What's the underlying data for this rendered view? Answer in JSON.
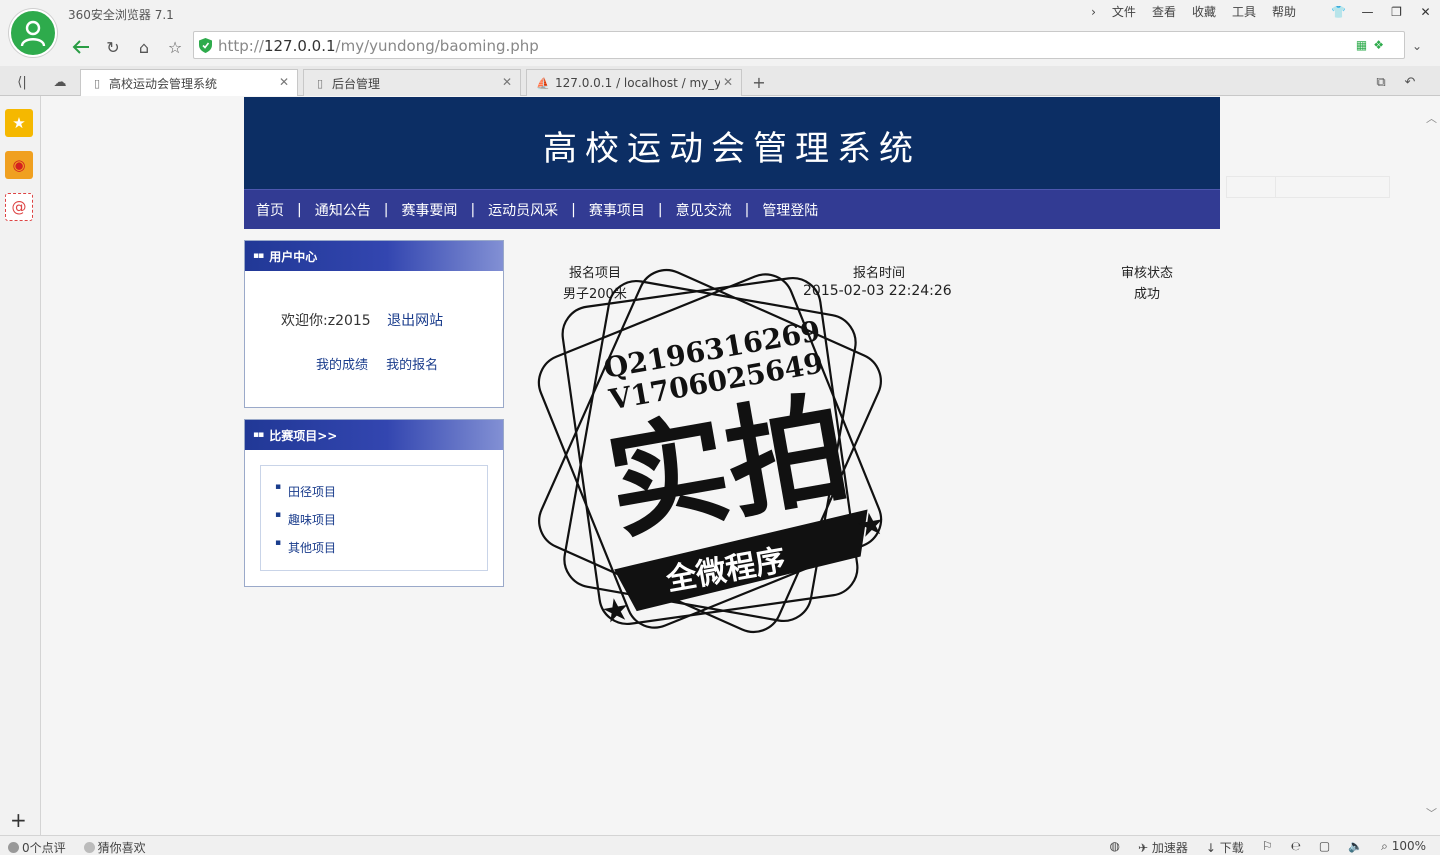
{
  "browser": {
    "app_title": "360安全浏览器 7.1",
    "menu": [
      "文件",
      "查看",
      "收藏",
      "工具",
      "帮助"
    ],
    "url_scheme": "http://",
    "url_host": "127.0.0.1",
    "url_path": "/my/yundong/baoming.php",
    "tabs": [
      {
        "label": "高校运动会管理系统",
        "active": true
      },
      {
        "label": "后台管理",
        "active": false
      },
      {
        "label": "127.0.0.1 / localhost / my_yu",
        "active": false
      }
    ],
    "status_left": [
      "0个点评",
      "猜你喜欢"
    ],
    "status_right": [
      "加速器",
      "下载",
      "100%"
    ]
  },
  "site": {
    "title": "高校运动会管理系统",
    "nav": [
      "首页",
      "通知公告",
      "赛事要闻",
      "运动员风采",
      "赛事项目",
      "意见交流",
      "管理登陆"
    ],
    "user_panel": {
      "title": "用户中心",
      "welcome": "欢迎你:z2015",
      "logout": "退出网站",
      "my_scores": "我的成绩",
      "my_registrations": "我的报名"
    },
    "events_panel": {
      "title": "比赛项目>>",
      "items": [
        "田径项目",
        "趣味项目",
        "其他项目"
      ]
    },
    "registration_table": {
      "headers": [
        "报名项目",
        "报名时间",
        "审核状态"
      ],
      "rows": [
        [
          "男子200米",
          "2015-02-03 22:24:26",
          "成功"
        ]
      ]
    }
  },
  "watermark": {
    "line1": "Q2196316269",
    "line2": "V1706025649",
    "big": "实拍",
    "banner": "全微程序"
  }
}
